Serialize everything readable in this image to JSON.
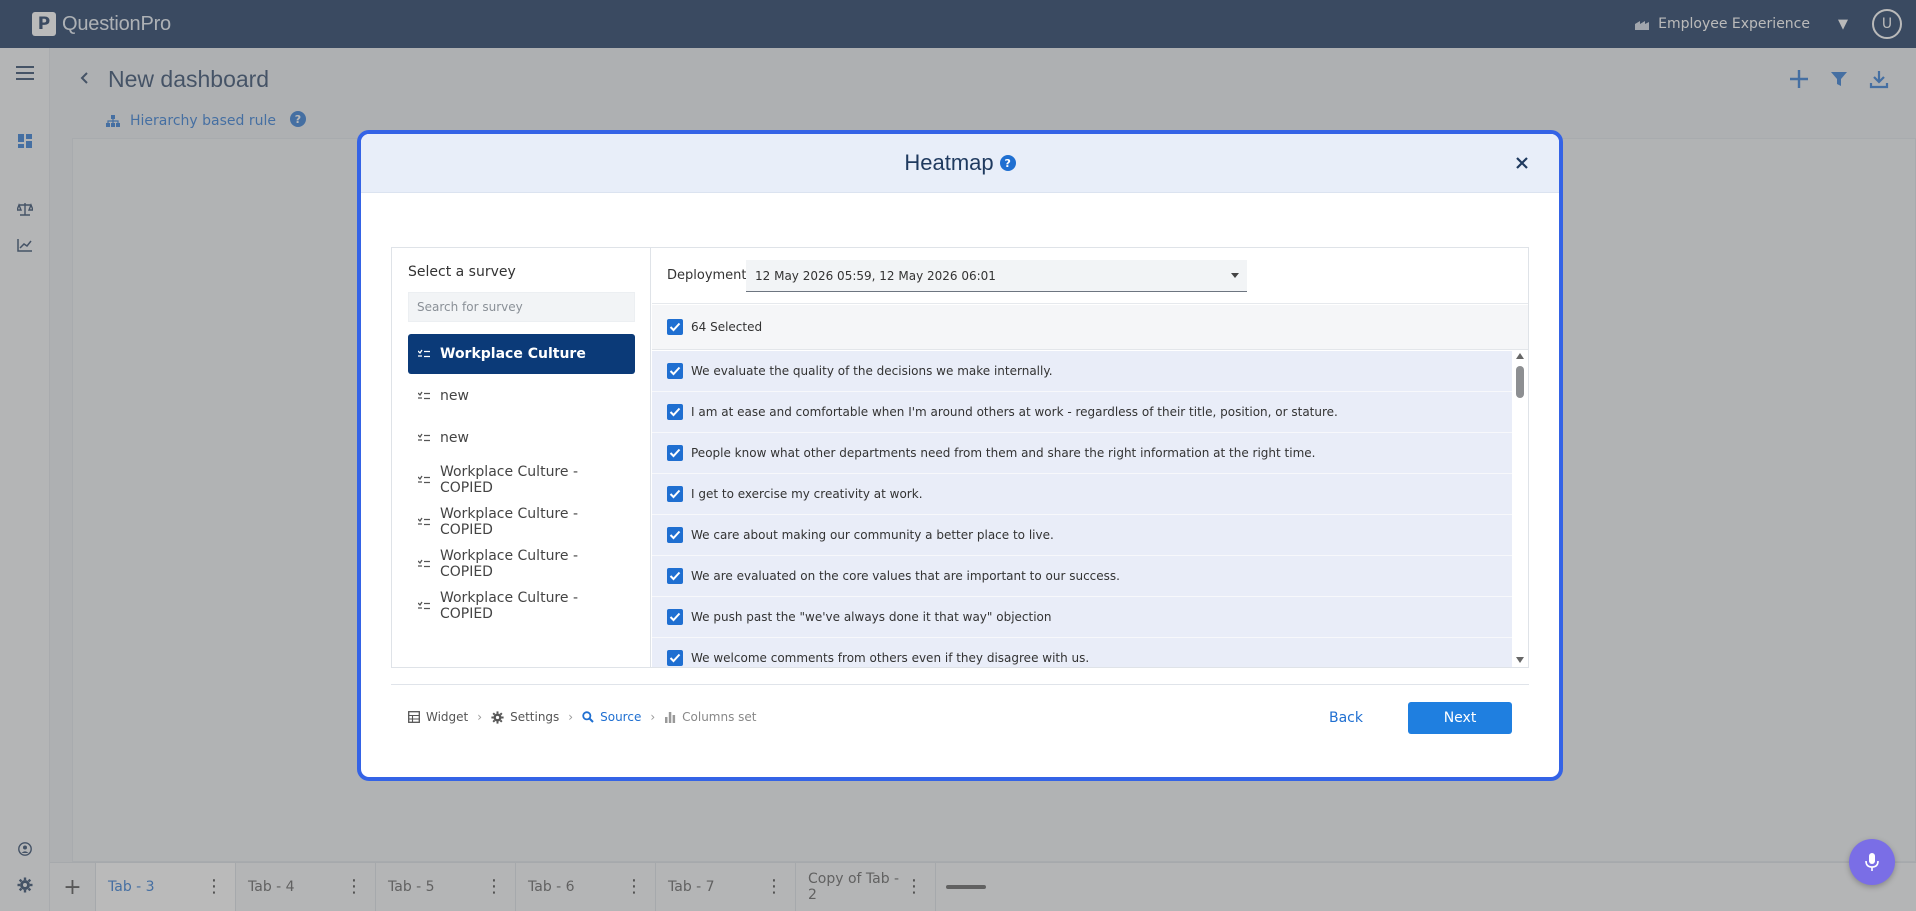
{
  "app": {
    "logo_text": "QuestionPro",
    "logo_letter": "P",
    "product": "Employee Experience",
    "user_initial": "U"
  },
  "page": {
    "title": "New dashboard",
    "rule_label": "Hierarchy based rule"
  },
  "tabs": [
    {
      "label": "Tab - 3",
      "active": true
    },
    {
      "label": "Tab - 4",
      "active": false
    },
    {
      "label": "Tab - 5",
      "active": false
    },
    {
      "label": "Tab - 6",
      "active": false
    },
    {
      "label": "Tab - 7",
      "active": false
    },
    {
      "label": "Copy of Tab - 2",
      "active": false
    }
  ],
  "modal": {
    "title": "Heatmap",
    "survey": {
      "label": "Select a survey",
      "search_placeholder": "Search for survey",
      "items": [
        {
          "label": "Workplace Culture",
          "active": true
        },
        {
          "label": "new",
          "active": false
        },
        {
          "label": "new",
          "active": false
        },
        {
          "label": "Workplace Culture - COPIED",
          "active": false
        },
        {
          "label": "Workplace Culture - COPIED",
          "active": false
        },
        {
          "label": "Workplace Culture - COPIED",
          "active": false
        },
        {
          "label": "Workplace Culture - COPIED",
          "active": false
        }
      ]
    },
    "deployment": {
      "label": "Deployment",
      "value": "12 May 2026 05:59, 12 May 2026 06:01"
    },
    "select_all_label": "64 Selected",
    "questions": [
      "We evaluate the quality of the decisions we make internally.",
      "I am at ease and comfortable when I'm around others at work - regardless of their title, position, or stature.",
      "People know what other departments need from them and share the right information at the right time.",
      "I get to exercise my creativity at work.",
      "We care about making our community a better place to live.",
      "We are evaluated on the core values that are important to our success.",
      "We push past the \"we've always done it that way\" objection",
      "We welcome comments from others even if they disagree with us."
    ],
    "steps": [
      {
        "label": "Widget",
        "icon": "table-icon",
        "state": "done"
      },
      {
        "label": "Settings",
        "icon": "gear-icon",
        "state": "done"
      },
      {
        "label": "Source",
        "icon": "search-icon",
        "state": "current"
      },
      {
        "label": "Columns set",
        "icon": "bar-chart-icon",
        "state": "disabled"
      }
    ],
    "back_label": "Back",
    "next_label": "Next"
  },
  "colors": {
    "topbar": "#0b2a55",
    "accent": "#1f6fd1",
    "active_survey": "#0b3a78",
    "modal_border": "#3463e6"
  }
}
